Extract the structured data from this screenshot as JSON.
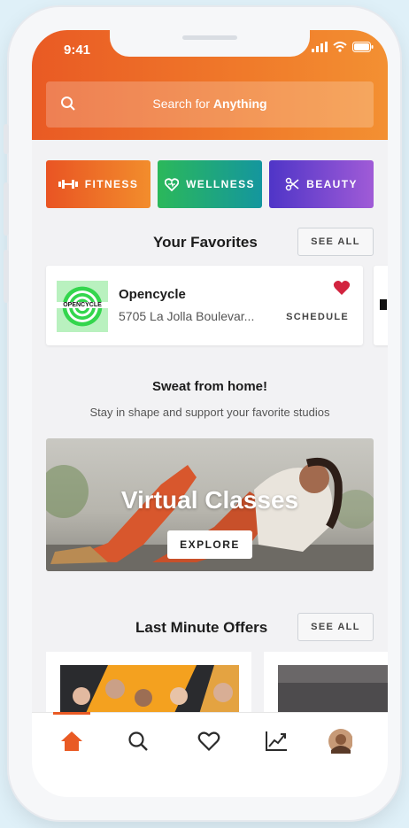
{
  "status_bar": {
    "time": "9:41"
  },
  "search": {
    "prefix": "Search for ",
    "bold": "Anything"
  },
  "categories": [
    {
      "label": "FITNESS",
      "icon": "dumbbell-icon"
    },
    {
      "label": "WELLNESS",
      "icon": "heart-icon"
    },
    {
      "label": "BEAUTY",
      "icon": "scissors-icon"
    }
  ],
  "favorites": {
    "title": "Your Favorites",
    "see_all": "SEE ALL",
    "card": {
      "logo_text": "OPENCYCLE",
      "name": "Opencycle",
      "address": "5705 La Jolla Boulevar...",
      "action": "SCHEDULE"
    }
  },
  "home": {
    "title": "Sweat from home!",
    "subtitle": "Stay in shape and support your favorite studios"
  },
  "banner": {
    "title": "Virtual Classes",
    "button": "EXPLORE"
  },
  "offers": {
    "title": "Last Minute Offers",
    "see_all": "SEE ALL"
  },
  "tabs": [
    "home-icon",
    "search-icon",
    "heart-icon",
    "chart-icon",
    "avatar"
  ],
  "colors": {
    "brand": "#e95a24",
    "fitness": "#f07a2a",
    "wellness": "#2bb85a",
    "beauty": "#7a46d0",
    "heart": "#d2243f"
  }
}
